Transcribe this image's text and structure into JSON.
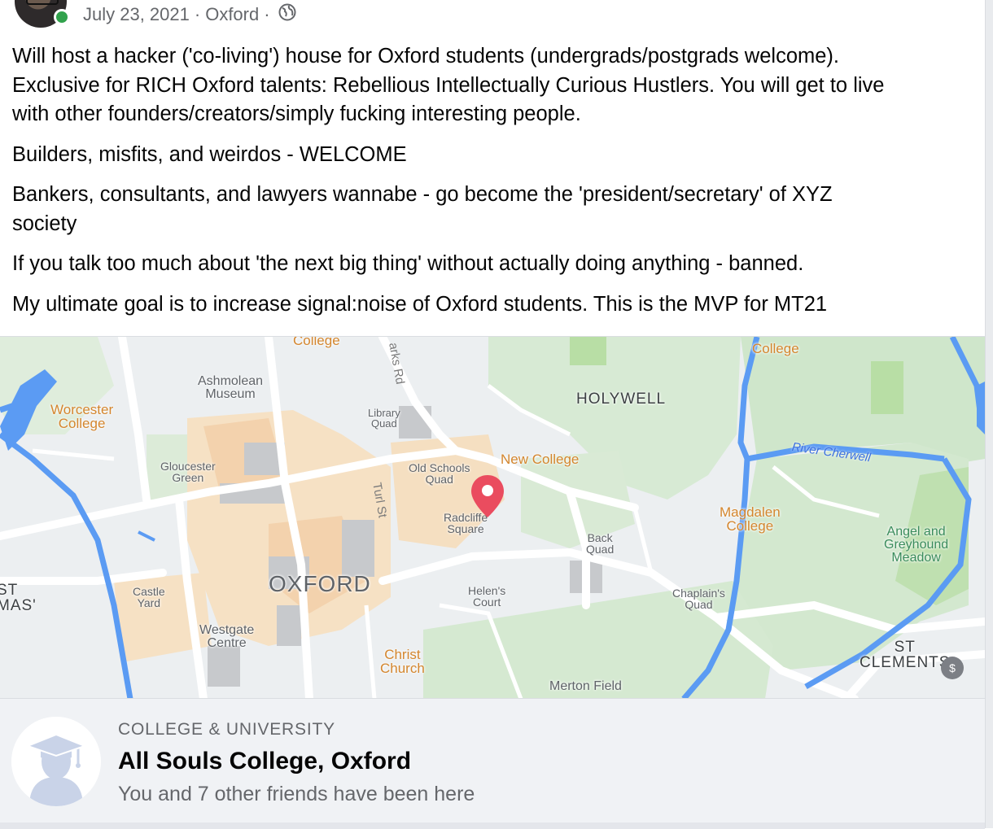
{
  "post": {
    "date": "July 23, 2021",
    "separator": "·",
    "location": "Oxford",
    "audience_icon": "globe-icon",
    "paragraphs": [
      "Will host a hacker ('co-living') house for Oxford students (undergrads/postgrads welcome).\nExclusive for RICH Oxford talents: Rebellious Intellectually Curious Hustlers. You will get to live\nwith other founders/creators/simply fucking interesting people.",
      "Builders, misfits, and weirdos - WELCOME",
      "Bankers, consultants, and lawyers wannabe - go become the 'president/secretary' of XYZ\nsociety",
      "If you talk too much about 'the next big thing' without actually doing anything - banned.",
      "My ultimate goal is to increase signal:noise of Oxford students. This is the MVP for MT21"
    ]
  },
  "map": {
    "labels": {
      "college_top": "College",
      "parks_rd": "arks Rd",
      "college_top_right": "College",
      "ashmolean": "Ashmolean\nMuseum",
      "worcester": "Worcester\nCollege",
      "library_quad": "Library\nQuad",
      "holywell": "HOLYWELL",
      "river_cherwell": "River Cherwell",
      "gloucester_green": "Gloucester\nGreen",
      "old_schools": "Old Schools\nQuad",
      "new_college": "New College",
      "turl_st": "Turl St",
      "radcliffe": "Radcliffe\nSquare",
      "magdalen": "Magdalen\nCollege",
      "back_quad": "Back\nQuad",
      "angel": "Angel and\nGreyhound\nMeadow",
      "st_left": "ST\nMAS'",
      "castle_yard": "Castle\nYard",
      "oxford": "OXFORD",
      "helens_court": "Helen's\nCourt",
      "chaplains_quad": "Chaplain's\nQuad",
      "westgate": "Westgate\nCentre",
      "christ_church": "Christ\nChurch",
      "st_clements": "ST\nCLEMENTS",
      "merton_field": "Merton Field"
    },
    "badge": "$"
  },
  "place": {
    "category": "COLLEGE & UNIVERSITY",
    "name": "All Souls College, Oxford",
    "visits": "You and 7 other friends have been here"
  }
}
